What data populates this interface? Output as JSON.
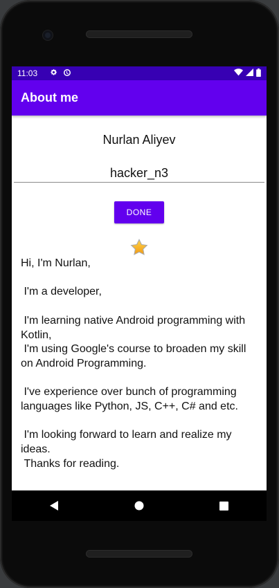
{
  "status_bar": {
    "time": "11:03",
    "icons": [
      "gear-icon",
      "data-saver-icon",
      "wifi-icon",
      "signal-icon",
      "battery-icon"
    ]
  },
  "app_bar": {
    "title": "About me"
  },
  "profile": {
    "name": "Nurlan Aliyev",
    "nickname": "hacker_n3"
  },
  "done_button": {
    "label": "DONE"
  },
  "star_icon": "star-icon",
  "bio": "Hi, I'm Nurlan,\n\n I'm a developer,\n\n I'm learning native Android programming with Kotlin,\n I'm using Google's course to broaden my skill on Android Programming.\n\n I've experience over bunch of programming languages like Python, JS, C++, C# and etc.\n\n I'm looking forward to learn and realize my ideas.\n Thanks for reading.",
  "colors": {
    "status_bar": "#3700b3",
    "primary": "#6200ee",
    "star": "#f8b81c"
  }
}
